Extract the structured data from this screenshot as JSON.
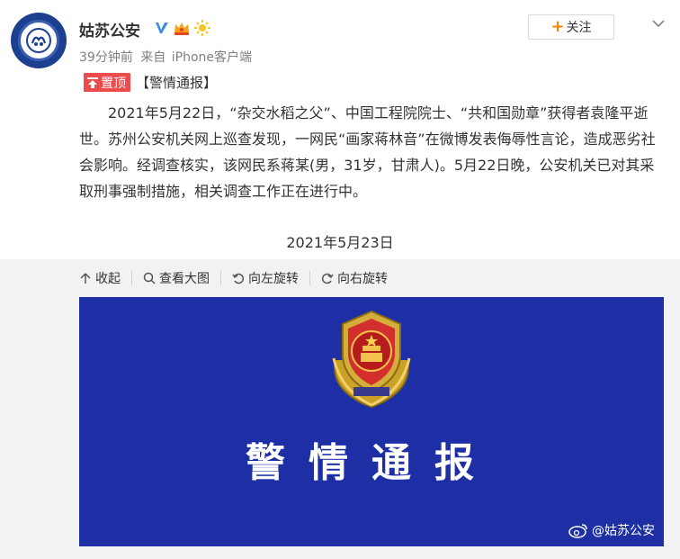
{
  "author": {
    "name": "姑苏公安"
  },
  "meta": {
    "time": "39分钟前",
    "source_prefix": "来自",
    "source": "iPhone客户端"
  },
  "actions": {
    "follow_label": "关注"
  },
  "post": {
    "pin_label": "置顶",
    "tag": "【警情通报】",
    "body": "2021年5月22日，“杂交水稻之父”、中国工程院院士、“共和国勋章”获得者袁隆平逝世。苏州公安机关网上巡查发现，一网民“画家蒋林音”在微博发表侮辱性言论，造成恶劣社会影响。经调查核实，该网民系蒋某(男，31岁，甘肃人)。5月22日晚，公安机关已对其采取刑事强制措施，相关调查工作正在进行中。",
    "date": "2021年5月23日"
  },
  "toolbar": {
    "collapse": "收起",
    "view_large": "查看大图",
    "rotate_left": "向左旋转",
    "rotate_right": "向右旋转"
  },
  "image": {
    "title": "警情通报",
    "watermark": "@姑苏公安",
    "background": "#1e2fa6"
  },
  "colors": {
    "accent": "#ff8200",
    "pin": "#eb4d4d",
    "verified": "#3c8ce7",
    "badge_blue": "#1d3f8f"
  }
}
